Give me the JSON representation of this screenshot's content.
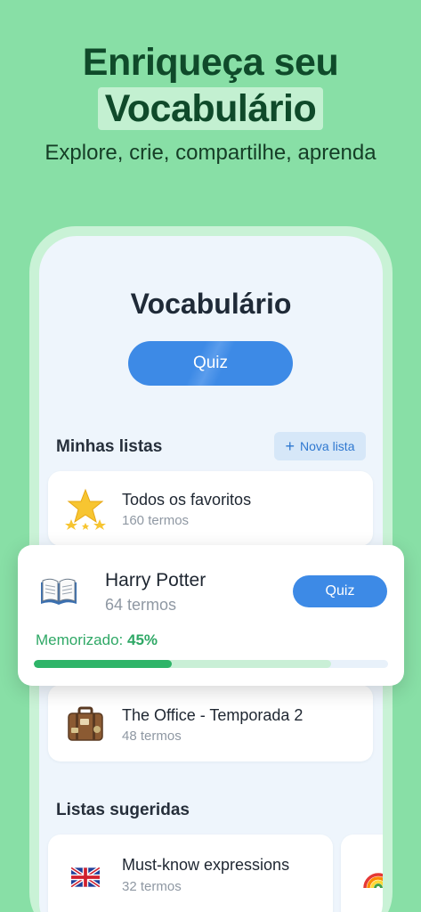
{
  "hero": {
    "title_line1": "Enriqueça seu",
    "title_line2": "Vocabulário",
    "subtitle": "Explore, crie, compartilhe, aprenda"
  },
  "screen": {
    "title": "Vocabulário",
    "quiz_label": "Quiz",
    "my_lists_label": "Minhas listas",
    "new_list_label": "Nova lista",
    "suggested_label": "Listas sugeridas"
  },
  "lists": [
    {
      "name": "Todos os favoritos",
      "count": "160 termos",
      "icon": "star-icon"
    },
    {
      "name": "Harry Potter",
      "count": "64 termos",
      "icon": "book-icon"
    },
    {
      "name": "The Office - Temporada 2",
      "count": "48 termos",
      "icon": "suitcase-icon"
    }
  ],
  "featured": {
    "name": "Harry Potter",
    "count": "64 termos",
    "quiz_label": "Quiz",
    "memorized_label": "Memorizado:",
    "memorized_value": "45%",
    "progress": 0.39,
    "buffer": 0.84
  },
  "suggested": [
    {
      "name": "Must-know expressions",
      "count": "32 termos",
      "icon": "uk-flag-icon"
    },
    {
      "name": "",
      "count": "",
      "icon": "rainbow-icon"
    }
  ],
  "colors": {
    "background": "#88dfa6",
    "headline": "#0f4a2a",
    "accent": "#3d8ae6",
    "progress": "#2eb468"
  }
}
